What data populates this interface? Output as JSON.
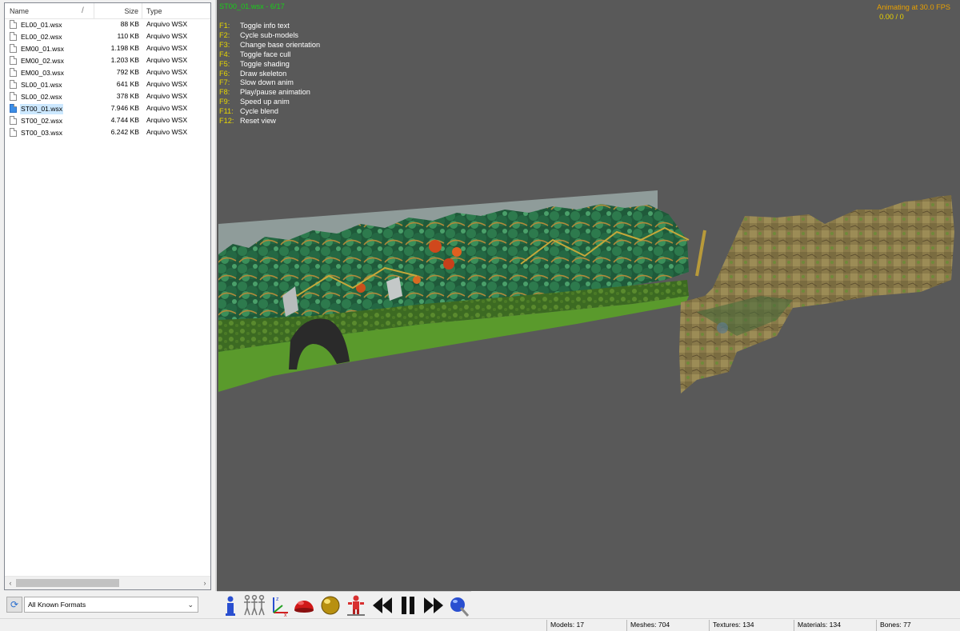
{
  "file_panel": {
    "columns": {
      "name": "Name",
      "sort_indicator": "/",
      "size": "Size",
      "type": "Type"
    },
    "files": [
      {
        "name": "EL00_01.wsx",
        "size": "88 KB",
        "type": "Arquivo WSX"
      },
      {
        "name": "EL00_02.wsx",
        "size": "110 KB",
        "type": "Arquivo WSX"
      },
      {
        "name": "EM00_01.wsx",
        "size": "1.198 KB",
        "type": "Arquivo WSX"
      },
      {
        "name": "EM00_02.wsx",
        "size": "1.203 KB",
        "type": "Arquivo WSX"
      },
      {
        "name": "EM00_03.wsx",
        "size": "792 KB",
        "type": "Arquivo WSX"
      },
      {
        "name": "SL00_01.wsx",
        "size": "641 KB",
        "type": "Arquivo WSX"
      },
      {
        "name": "SL00_02.wsx",
        "size": "378 KB",
        "type": "Arquivo WSX"
      },
      {
        "name": "ST00_01.wsx",
        "size": "7.946 KB",
        "type": "Arquivo WSX",
        "selected": true
      },
      {
        "name": "ST00_02.wsx",
        "size": "4.744 KB",
        "type": "Arquivo WSX"
      },
      {
        "name": "ST00_03.wsx",
        "size": "6.242 KB",
        "type": "Arquivo WSX"
      }
    ],
    "scroll_left": "‹",
    "scroll_right": "›",
    "refresh_icon": "refresh-icon",
    "filter": {
      "selected": "All Known Formats"
    }
  },
  "viewport": {
    "title": "ST00_01.wsx - 6/17",
    "fps_text": "Animating at 30.0 FPS",
    "frame_text": "0.00 / 0",
    "shortcuts": [
      {
        "key": "F1:",
        "desc": "Toggle info text"
      },
      {
        "key": "F2:",
        "desc": "Cycle sub-models"
      },
      {
        "key": "F3:",
        "desc": "Change base orientation"
      },
      {
        "key": "F4:",
        "desc": "Toggle face cull"
      },
      {
        "key": "F5:",
        "desc": "Toggle shading"
      },
      {
        "key": "F6:",
        "desc": "Draw skeleton"
      },
      {
        "key": "F7:",
        "desc": "Slow down anim"
      },
      {
        "key": "F8:",
        "desc": "Play/pause animation"
      },
      {
        "key": "F9:",
        "desc": "Speed up anim"
      },
      {
        "key": "F11:",
        "desc": "Cycle blend"
      },
      {
        "key": "F12:",
        "desc": "Reset view"
      }
    ],
    "colors": {
      "background": "#595959",
      "title": "#18d018",
      "keys": "#e8d800",
      "fps": "#e8a000"
    }
  },
  "toolbar": {
    "buttons": [
      "info-icon",
      "skeleton-figures-icon",
      "axes-icon",
      "red-dome-icon",
      "gold-sphere-icon",
      "red-figure-icon",
      "rewind-icon",
      "pause-icon",
      "fast-forward-icon",
      "globe-wand-icon"
    ]
  },
  "statusbar": {
    "models": "Models: 17",
    "meshes": "Meshes: 704",
    "textures": "Textures: 134",
    "materials": "Materials: 134",
    "bones": "Bones: 77"
  }
}
